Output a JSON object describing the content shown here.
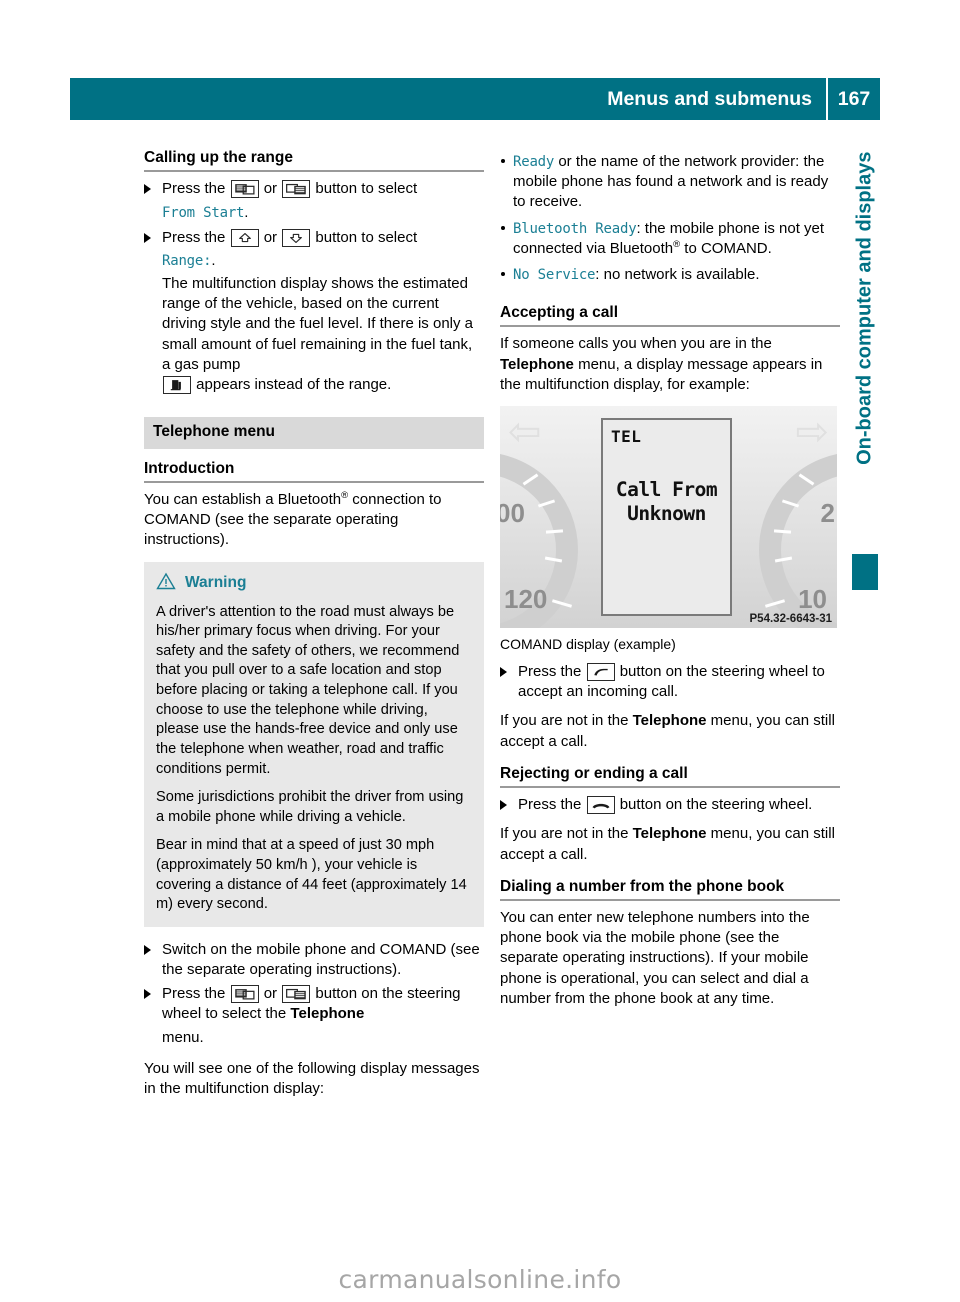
{
  "header": {
    "title": "Menus and submenus",
    "page_number": "167",
    "bar_color": "#007184"
  },
  "side_tab": {
    "label": "On-board computer and displays",
    "color": "#007184"
  },
  "left_column": {
    "heading": "Calling up the range",
    "steps": [
      {
        "text_before": "Press the",
        "icon_a": "panel-left-button-icon",
        "or_text": "or",
        "icon_b": "panel-right-button-icon",
        "text_after": "button to select",
        "value": "From Start",
        "value_suffix": "."
      },
      {
        "text_before": "Press the",
        "icon_a": "arrow-up-button-icon",
        "or_text": "or",
        "icon_b": "arrow-down-button-icon",
        "text_after": "button to select",
        "value": "Range:",
        "value_suffix": "."
      }
    ],
    "step_note_1": "The multifunction display shows the estimated range of the vehicle, based on the current driving style and the fuel level. If there is only a small amount of fuel remaining in the fuel tank, a gas pump",
    "step_note_1_tail": "appears instead of the range.",
    "gas_pump_icon": "gas-pump-icon",
    "section_band": "Telephone menu",
    "introduction_heading": "Introduction",
    "introduction_text_1": "You can establish a Bluetooth",
    "introduction_text_2": " connection to COMAND (see the separate operating instructions).",
    "warning": {
      "icon": "warning-triangle-icon",
      "label": "Warning",
      "paragraphs": [
        "A driver's attention to the road must always be his/her primary focus when driving. For your safety and the safety of others, we recommend that you pull over to a safe location and stop before placing or taking a telephone call. If you choose to use the telephone while driving, please use the hands-free device and only use the telephone when weather, road and traffic conditions permit.",
        "Some jurisdictions prohibit the driver from using a mobile phone while driving a vehicle.",
        "Bear in mind that at a speed of just 30 mph (approximately 50 km/h ), your vehicle is covering a distance of 44 feet (approximately 14 m) every second."
      ]
    },
    "steps_2": [
      {
        "text": "Switch on the mobile phone and COMAND (see the separate operating instructions)."
      }
    ],
    "step_press": {
      "text_before": "Press the",
      "icon_a": "panel-left-button-icon",
      "or_text": "or",
      "icon_b": "panel-right-button-icon",
      "text_after_1": "button on the steering wheel to select the",
      "bold_term": "Telephone",
      "text_after_2": "menu."
    },
    "closing_text": "You will see one of the following display messages in the multifunction display:"
  },
  "right_column": {
    "status_items": [
      {
        "value": "Ready",
        "rest": " or the name of the network provider: the mobile phone has found a network and is ready to receive."
      },
      {
        "value": "Bluetooth Ready",
        "rest": ": the mobile phone is not yet connected via Bluetooth",
        "rest_2": " to COMAND."
      },
      {
        "value": "No Service",
        "rest": ": no network is available."
      }
    ],
    "accepting": {
      "heading": "Accepting a call",
      "intro_1": "If someone calls you when you are in the",
      "bold_term": "Telephone",
      "intro_2": "menu, a display message appears in the multifunction display, for example:",
      "figure": {
        "mfd_title": "TEL",
        "mfd_line_1": "Call From",
        "mfd_line_2": "Unknown",
        "code": "P54.32-6643-31",
        "gauge_left_upper": "00",
        "gauge_left_lower": "120",
        "gauge_right_upper": "2",
        "gauge_right_lower": "10",
        "caption": "COMAND display (example)"
      },
      "step": {
        "text_before": "Press the",
        "icon": "phone-accept-button-icon",
        "text_after": "button on the steering wheel to accept an incoming call."
      },
      "note_1": "If you are not in the",
      "note_bold": "Telephone",
      "note_2": "menu, you can still accept a call."
    },
    "rejecting": {
      "heading": "Rejecting or ending a call",
      "step": {
        "text_before": "Press the",
        "icon": "phone-reject-button-icon",
        "text_after": "button on the steering wheel."
      },
      "note_1": "If you are not in the",
      "note_bold": "Telephone",
      "note_2": "menu, you can still accept a call."
    },
    "dialing": {
      "heading": "Dialing a number from the phone book",
      "text": "You can enter new telephone numbers into the phone book via the mobile phone (see the separate operating instructions). If your mobile phone is operational, you can select and dial a number from the phone book at any time."
    }
  },
  "watermark": "carmanualsonline.info"
}
